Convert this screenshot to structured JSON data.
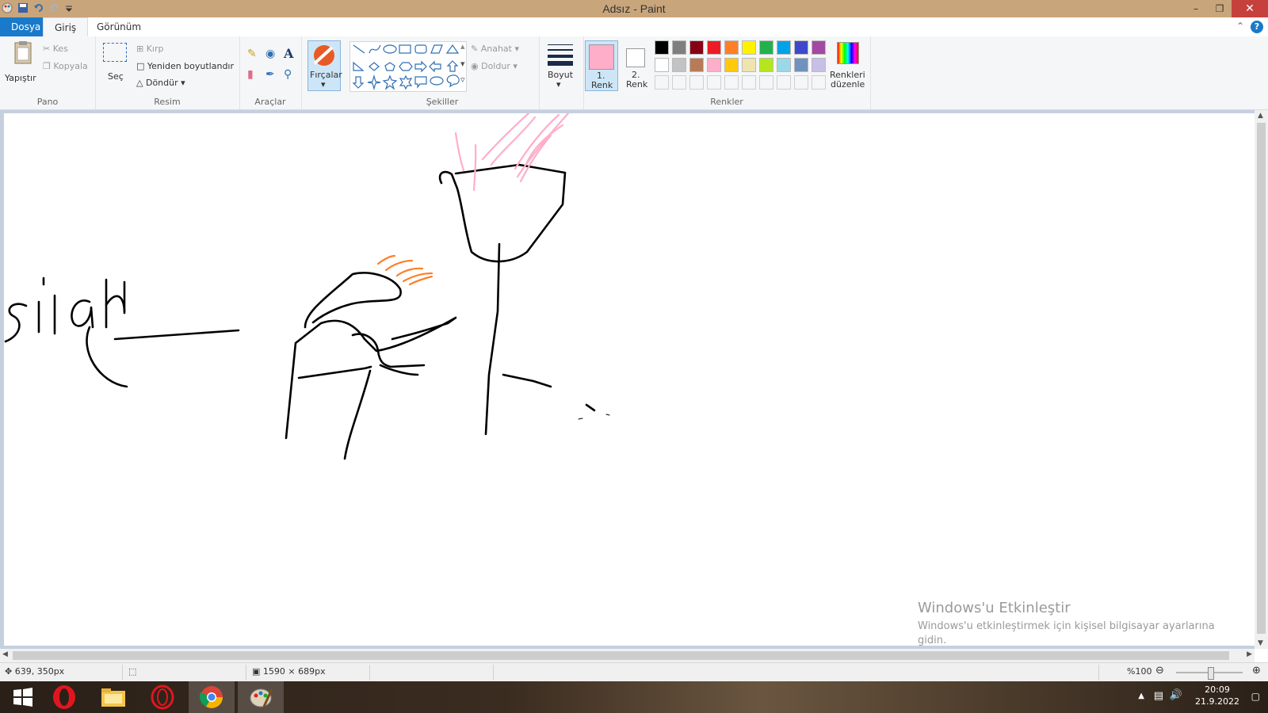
{
  "window": {
    "title": "Adsız - Paint"
  },
  "tabs": {
    "file": "Dosya",
    "home": "Giriş",
    "view": "Görünüm"
  },
  "ribbon": {
    "clipboard": {
      "paste": "Yapıştır",
      "cut": "Kes",
      "copy": "Kopyala",
      "group": "Pano"
    },
    "image": {
      "select": "Seç",
      "crop": "Kırp",
      "resize": "Yeniden boyutlandır",
      "rotate": "Döndür",
      "group": "Resim"
    },
    "tools": {
      "group": "Araçlar"
    },
    "brushes": {
      "label": "Fırçalar"
    },
    "shapes": {
      "outline": "Anahat",
      "fill": "Doldur",
      "group": "Şekiller"
    },
    "size": {
      "label": "Boyut"
    },
    "colors": {
      "color1_a": "1.",
      "color1_b": "Renk",
      "color2_a": "2.",
      "color2_b": "Renk",
      "edit_a": "Renkleri",
      "edit_b": "düzenle",
      "group": "Renkler",
      "color1_value": "#ffaec9",
      "color2_value": "#ffffff",
      "palette_row1": [
        "#000000",
        "#7f7f7f",
        "#880015",
        "#ed1c24",
        "#ff7f27",
        "#fff200",
        "#22b14c",
        "#00a2e8",
        "#3f48cc",
        "#a349a4"
      ],
      "palette_row2": [
        "#ffffff",
        "#c3c3c3",
        "#b97a57",
        "#ffaec9",
        "#ffc90e",
        "#efe4b0",
        "#b5e61d",
        "#99d9ea",
        "#7092be",
        "#c8bfe7"
      ]
    }
  },
  "canvas": {
    "drawn_text": "silah"
  },
  "status": {
    "cursor": "639, 350px",
    "size": "1590 × 689px",
    "zoom": "%100"
  },
  "watermark": {
    "title": "Windows'u Etkinleştir",
    "body": "Windows'u etkinleştirmek için kişisel bilgisayar ayarlarına gidin."
  },
  "taskbar": {
    "time": "20:09",
    "date": "21.9.2022"
  }
}
